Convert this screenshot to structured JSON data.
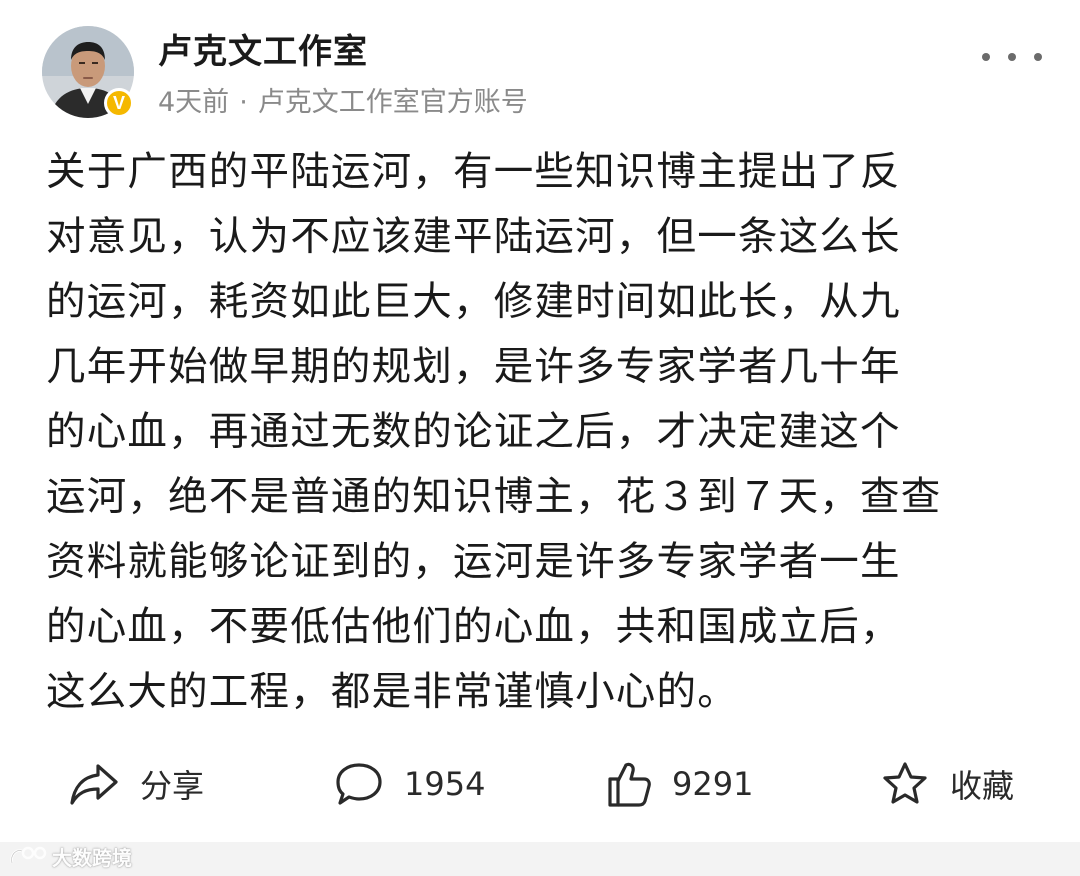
{
  "post": {
    "author": {
      "name": "卢克文工作室",
      "verified_badge": "V"
    },
    "meta": {
      "time": "4天前",
      "separator": "·",
      "source": "卢克文工作室官方账号"
    },
    "content_lines": [
      "关于广西的平陆运河，有一些知识博主提出了反",
      "对意见，认为不应该建平陆运河，但一条这么长",
      "的运河，耗资如此巨大，修建时间如此长，从九",
      "几年开始做早期的规划，是许多专家学者几十年",
      "的心血，再通过无数的论证之后，才决定建这个",
      "运河，绝不是普通的知识博主，花３到７天，查查",
      "资料就能够论证到的，运河是许多专家学者一生",
      "的心血，不要低估他们的心血，共和国成立后，",
      "这么大的工程，都是非常谨慎小心的。"
    ],
    "actions": {
      "share_label": "分享",
      "comment_count": "1954",
      "like_count": "9291",
      "favorite_label": "收藏"
    }
  },
  "watermark": {
    "text": "大数跨境"
  },
  "icons": {
    "share": "share-arrow-icon",
    "comment": "comment-bubble-icon",
    "like": "thumbs-up-icon",
    "favorite": "star-icon",
    "more": "more-dots-icon",
    "verified": "verified-v-icon"
  },
  "colors": {
    "text_primary": "#1a1a1a",
    "text_secondary": "#8a8a8a",
    "verified_badge": "#f5b800",
    "background": "#ffffff"
  }
}
